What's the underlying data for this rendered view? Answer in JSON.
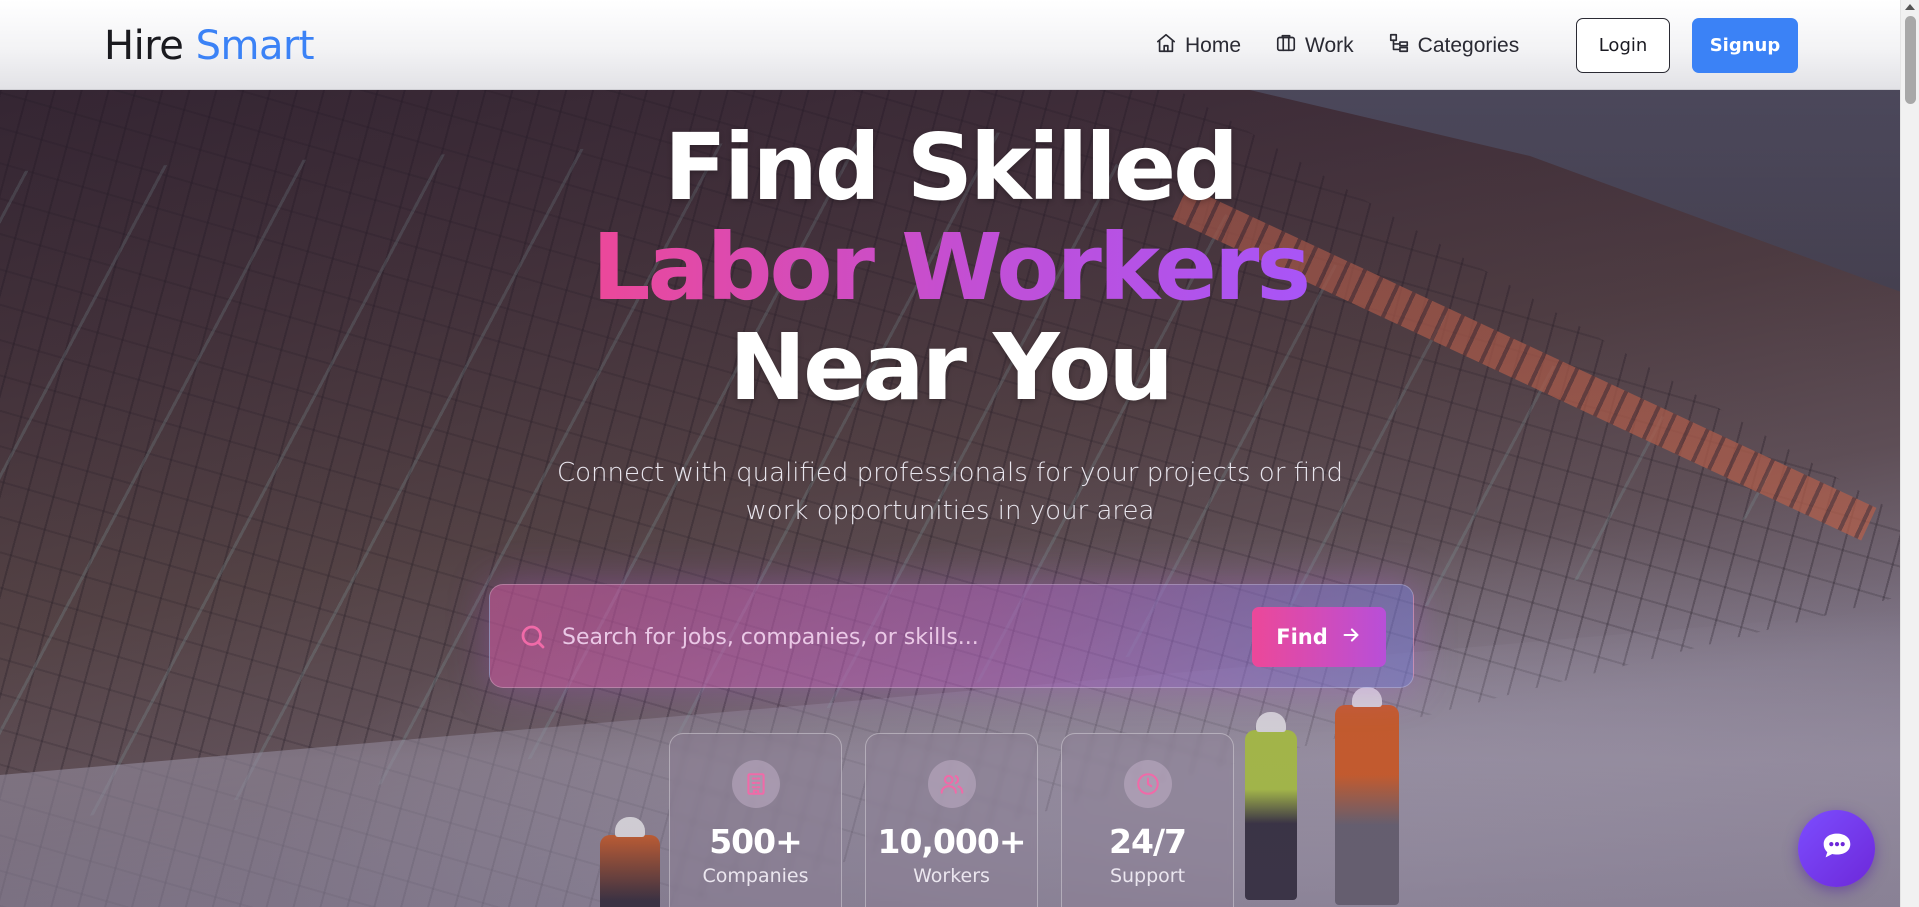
{
  "brand": {
    "name_part1": "Hire",
    "name_part2": "Smart",
    "accent_color": "#3b82f6"
  },
  "nav": {
    "links": [
      {
        "label": "Home",
        "icon": "home-icon"
      },
      {
        "label": "Work",
        "icon": "briefcase-icon"
      },
      {
        "label": "Categories",
        "icon": "categories-icon"
      }
    ],
    "login_label": "Login",
    "signup_label": "Signup"
  },
  "hero": {
    "line1": "Find Skilled",
    "line2": "Labor Workers",
    "line3": "Near You",
    "subtitle": "Connect with qualified professionals for your projects or find work opportunities in your area",
    "gradient_colors": [
      "#ec4899",
      "#a855f7"
    ]
  },
  "search": {
    "placeholder": "Search for jobs, companies, or skills...",
    "value": "",
    "button_label": "Find",
    "icon": "search-icon"
  },
  "stats": [
    {
      "value": "500+",
      "label": "Companies",
      "icon": "building-icon"
    },
    {
      "value": "10,000+",
      "label": "Workers",
      "icon": "users-icon"
    },
    {
      "value": "24/7",
      "label": "Support",
      "icon": "clock-icon"
    }
  ],
  "chat": {
    "icon": "chat-icon",
    "color": "#7c4dff"
  }
}
